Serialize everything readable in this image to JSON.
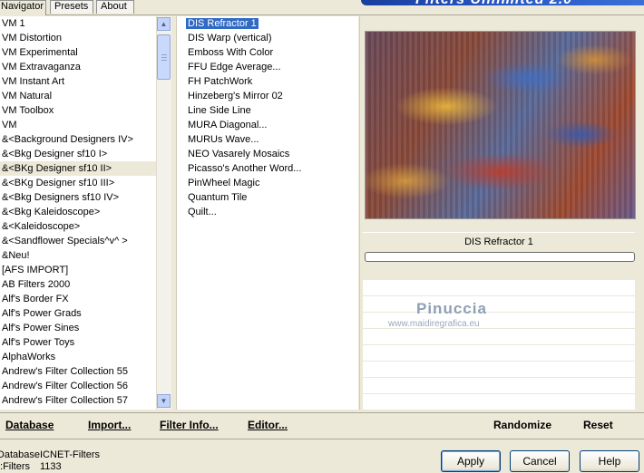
{
  "tabs": [
    "Navigator",
    "Presets",
    "About"
  ],
  "header_text": "Filters Unlimited 2.0",
  "categories": [
    "VM 1",
    "VM Distortion",
    "VM Experimental",
    "VM Extravaganza",
    "VM Instant Art",
    "VM Natural",
    "VM Toolbox",
    "VM",
    "&<Background Designers IV>",
    "&<Bkg Designer sf10 I>",
    "&<BKg Designer sf10 II>",
    "&<BKg Designer sf10 III>",
    "&<Bkg Designers sf10 IV>",
    "&<Bkg Kaleidoscope>",
    "&<Kaleidoscope>",
    "&<Sandflower Specials^v^ >",
    "&Neu!",
    "[AFS IMPORT]",
    "AB Filters 2000",
    "Alf's Border FX",
    "Alf's Power Grads",
    "Alf's Power Sines",
    "Alf's Power Toys",
    "AlphaWorks",
    "Andrew's Filter Collection 55",
    "Andrew's Filter Collection 56",
    "Andrew's Filter Collection 57"
  ],
  "selected_category": "&<BKg Designer sf10 II>",
  "filters": [
    "DIS Refractor 1",
    "DIS Warp (vertical)",
    "Emboss With Color",
    "FFU Edge Average...",
    "FH PatchWork",
    "Hinzeberg's Mirror 02",
    "Line Side Line",
    "MURA Diagonal...",
    "MURUs Wave...",
    "NEO Vasarely Mosaics",
    "Picasso's Another Word...",
    "PinWheel Magic",
    "Quantum Tile",
    "Quilt..."
  ],
  "selected_filter": "DIS Refractor 1",
  "preview_filter_name": "DIS Refractor 1",
  "watermark": {
    "name": "Pinuccia",
    "site": "www.maidiregrafica.eu"
  },
  "actions": {
    "database": "Database",
    "import": "Import...",
    "filter_info": "Filter Info...",
    "editor": "Editor...",
    "randomize": "Randomize",
    "reset": "Reset"
  },
  "info": {
    "database_label": "Database:",
    "database_value": "ICNET-Filters",
    "filters_label": "Filters:",
    "filters_value": "1133"
  },
  "buttons": {
    "apply": "Apply",
    "cancel": "Cancel",
    "help": "Help"
  },
  "scroll_arrows": {
    "up": "▲",
    "down": "▼"
  }
}
